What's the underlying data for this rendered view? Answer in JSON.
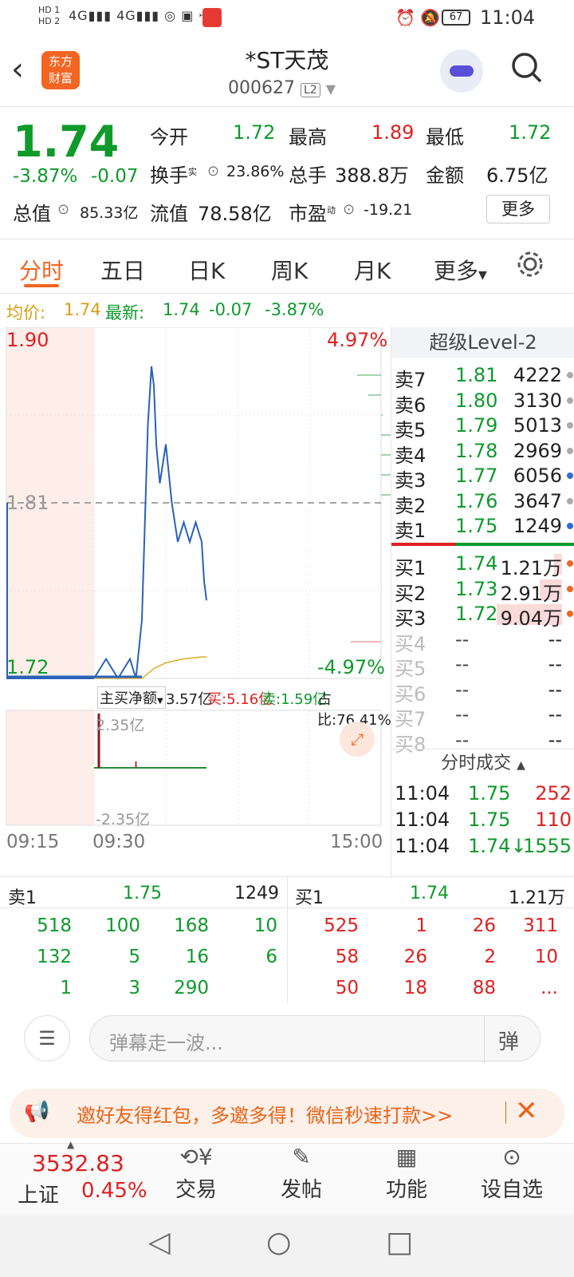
{
  "status": {
    "time": "11:04",
    "battery": "67"
  },
  "header": {
    "logo_line1": "东方",
    "logo_line2": "财富",
    "name": "*ST天茂",
    "code": "000627",
    "level_badge": "L2"
  },
  "quote": {
    "price": "1.74",
    "change_pct": "-3.87%",
    "change": "-0.07",
    "open_label": "今开",
    "open": "1.72",
    "high_label": "最高",
    "high": "1.89",
    "low_label": "最低",
    "low": "1.72",
    "turnover_label": "换手",
    "turnover_sup": "实",
    "turnover": "23.86%",
    "volume_label": "总手",
    "volume": "388.8万",
    "amount_label": "金额",
    "amount": "6.75亿",
    "mktcap_label": "总值",
    "mktcap": "85.33亿",
    "float_label": "流值",
    "float": "78.58亿",
    "pe_label": "市盈",
    "pe_sup": "动",
    "pe": "-19.21",
    "more_label": "更多"
  },
  "tabs": [
    "分时",
    "五日",
    "日K",
    "周K",
    "月K",
    "更多"
  ],
  "avg": {
    "avg_label": "均价:",
    "avg_value": "1.74",
    "latest_label": "最新:",
    "latest": "1.74",
    "chg": "-0.07",
    "pct": "-3.87%"
  },
  "chart": {
    "y_top": "1.90",
    "y_mid": "1.81",
    "y_bottom": "1.72",
    "pct_top": "4.97%",
    "pct_bottom": "-4.97%",
    "times": [
      "09:15",
      "09:30",
      "15:00"
    ]
  },
  "netbuy": {
    "label": "主买净额",
    "value": "3.57亿",
    "buy": "买:5.16亿",
    "sell": "卖:1.59亿",
    "ratio": "占比:76.41%",
    "top": "2.35亿",
    "bottom": "-2.35亿"
  },
  "chart_data": {
    "type": "line",
    "title": "",
    "x_range": [
      "09:15",
      "15:00"
    ],
    "ylim": [
      1.72,
      1.9
    ],
    "prev_close": 1.81,
    "series": [
      {
        "name": "",
        "x": [
          "09:15",
          "09:29",
          "09:30",
          "09:40",
          "09:50",
          "10:00",
          "10:05",
          "10:10",
          "10:15",
          "10:18",
          "10:20",
          "10:22",
          "10:25",
          "10:30",
          "10:35",
          "10:40",
          "10:45",
          "10:50",
          "10:55",
          "11:00",
          "11:02",
          "11:04"
        ],
        "values": [
          1.72,
          1.72,
          1.72,
          1.73,
          1.72,
          1.73,
          1.72,
          1.75,
          1.85,
          1.88,
          1.87,
          1.84,
          1.82,
          1.84,
          1.81,
          1.79,
          1.8,
          1.79,
          1.8,
          1.79,
          1.77,
          1.76
        ]
      },
      {
        "name": "均价",
        "x": [
          "09:30",
          "10:10",
          "10:20",
          "10:30",
          "10:45",
          "11:00",
          "11:04"
        ],
        "values": [
          1.72,
          1.72,
          1.725,
          1.728,
          1.73,
          1.731,
          1.731
        ]
      }
    ]
  },
  "level2": {
    "title": "超级Level-2",
    "asks": [
      {
        "label": "卖7",
        "price": "1.81",
        "vol": "4222"
      },
      {
        "label": "卖6",
        "price": "1.80",
        "vol": "3130"
      },
      {
        "label": "卖5",
        "price": "1.79",
        "vol": "5013"
      },
      {
        "label": "卖4",
        "price": "1.78",
        "vol": "2969"
      },
      {
        "label": "卖3",
        "price": "1.77",
        "vol": "6056"
      },
      {
        "label": "卖2",
        "price": "1.76",
        "vol": "3647"
      },
      {
        "label": "卖1",
        "price": "1.75",
        "vol": "1249"
      }
    ],
    "bids": [
      {
        "label": "买1",
        "price": "1.74",
        "vol": "1.21万"
      },
      {
        "label": "买2",
        "price": "1.73",
        "vol": "2.91万"
      },
      {
        "label": "买3",
        "price": "1.72",
        "vol": "9.04万"
      },
      {
        "label": "买4",
        "price": "--",
        "vol": "--"
      },
      {
        "label": "买5",
        "price": "--",
        "vol": "--"
      },
      {
        "label": "买6",
        "price": "--",
        "vol": "--"
      },
      {
        "label": "买7",
        "price": "--",
        "vol": "--"
      },
      {
        "label": "买8",
        "price": "--",
        "vol": "--"
      }
    ],
    "ticks_title": "分时成交",
    "ticks": [
      {
        "time": "11:04",
        "price": "1.75",
        "vol": "252"
      },
      {
        "time": "11:04",
        "price": "1.75",
        "vol": "110"
      },
      {
        "time": "11:04",
        "price": "1.74↓",
        "vol": "1555"
      }
    ]
  },
  "queue": {
    "sell_label": "卖1",
    "sell_price": "1.75",
    "sell_vol": "1249",
    "buy_label": "买1",
    "buy_price": "1.74",
    "buy_vol": "1.21万",
    "sell_rows": [
      [
        "518",
        "100",
        "168",
        "10"
      ],
      [
        "132",
        "5",
        "16",
        "6"
      ],
      [
        "1",
        "3",
        "290",
        ""
      ]
    ],
    "buy_rows": [
      [
        "525",
        "1",
        "26",
        "311"
      ],
      [
        "58",
        "26",
        "2",
        "10"
      ],
      [
        "50",
        "18",
        "88",
        "..."
      ]
    ]
  },
  "danmu": {
    "placeholder": "弹幕走一波...",
    "send_label": "弹"
  },
  "banner": {
    "text": "邀好友得红包，多邀多得！微信秒速打款>>"
  },
  "nav": {
    "index_value": "3532.83",
    "index_name": "上证",
    "index_pct": "0.45%",
    "items": [
      "交易",
      "发帖",
      "功能",
      "设自选"
    ]
  }
}
